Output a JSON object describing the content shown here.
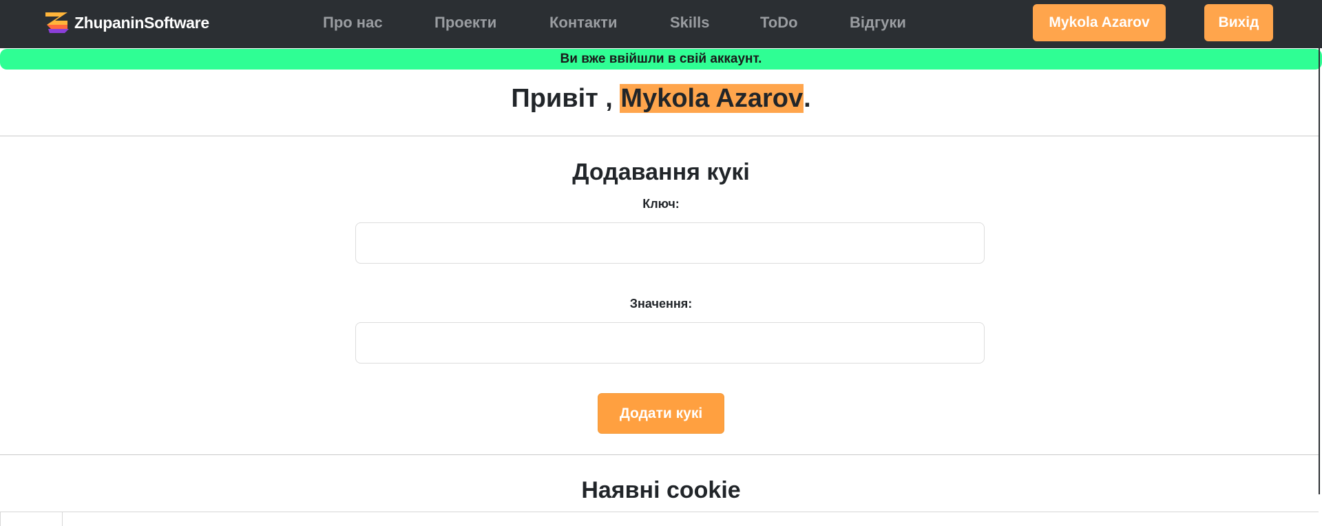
{
  "navbar": {
    "brand": "ZhupaninSoftware",
    "links": [
      "Про нас",
      "Проекти",
      "Контакти",
      "Skills",
      "ToDo",
      "Відгуки"
    ],
    "user_button": "Mykola Azarov",
    "logout_button": "Вихід"
  },
  "alert": {
    "message": "Ви вже ввійшли в свій аккаунт."
  },
  "greeting": {
    "prefix": "Привіт ,",
    "name": "Mykola Azarov",
    "suffix": "."
  },
  "add_cookie": {
    "title": "Додавання кукі",
    "key_label": "Ключ:",
    "key_value": "",
    "value_label": "Значення:",
    "value_value": "",
    "submit_label": "Додати кукі"
  },
  "cookies": {
    "title": "Наявні cookie"
  },
  "colors": {
    "navbar_bg": "#2b2f33",
    "accent": "#ffa54c",
    "alert_bg": "#2ffe94"
  }
}
